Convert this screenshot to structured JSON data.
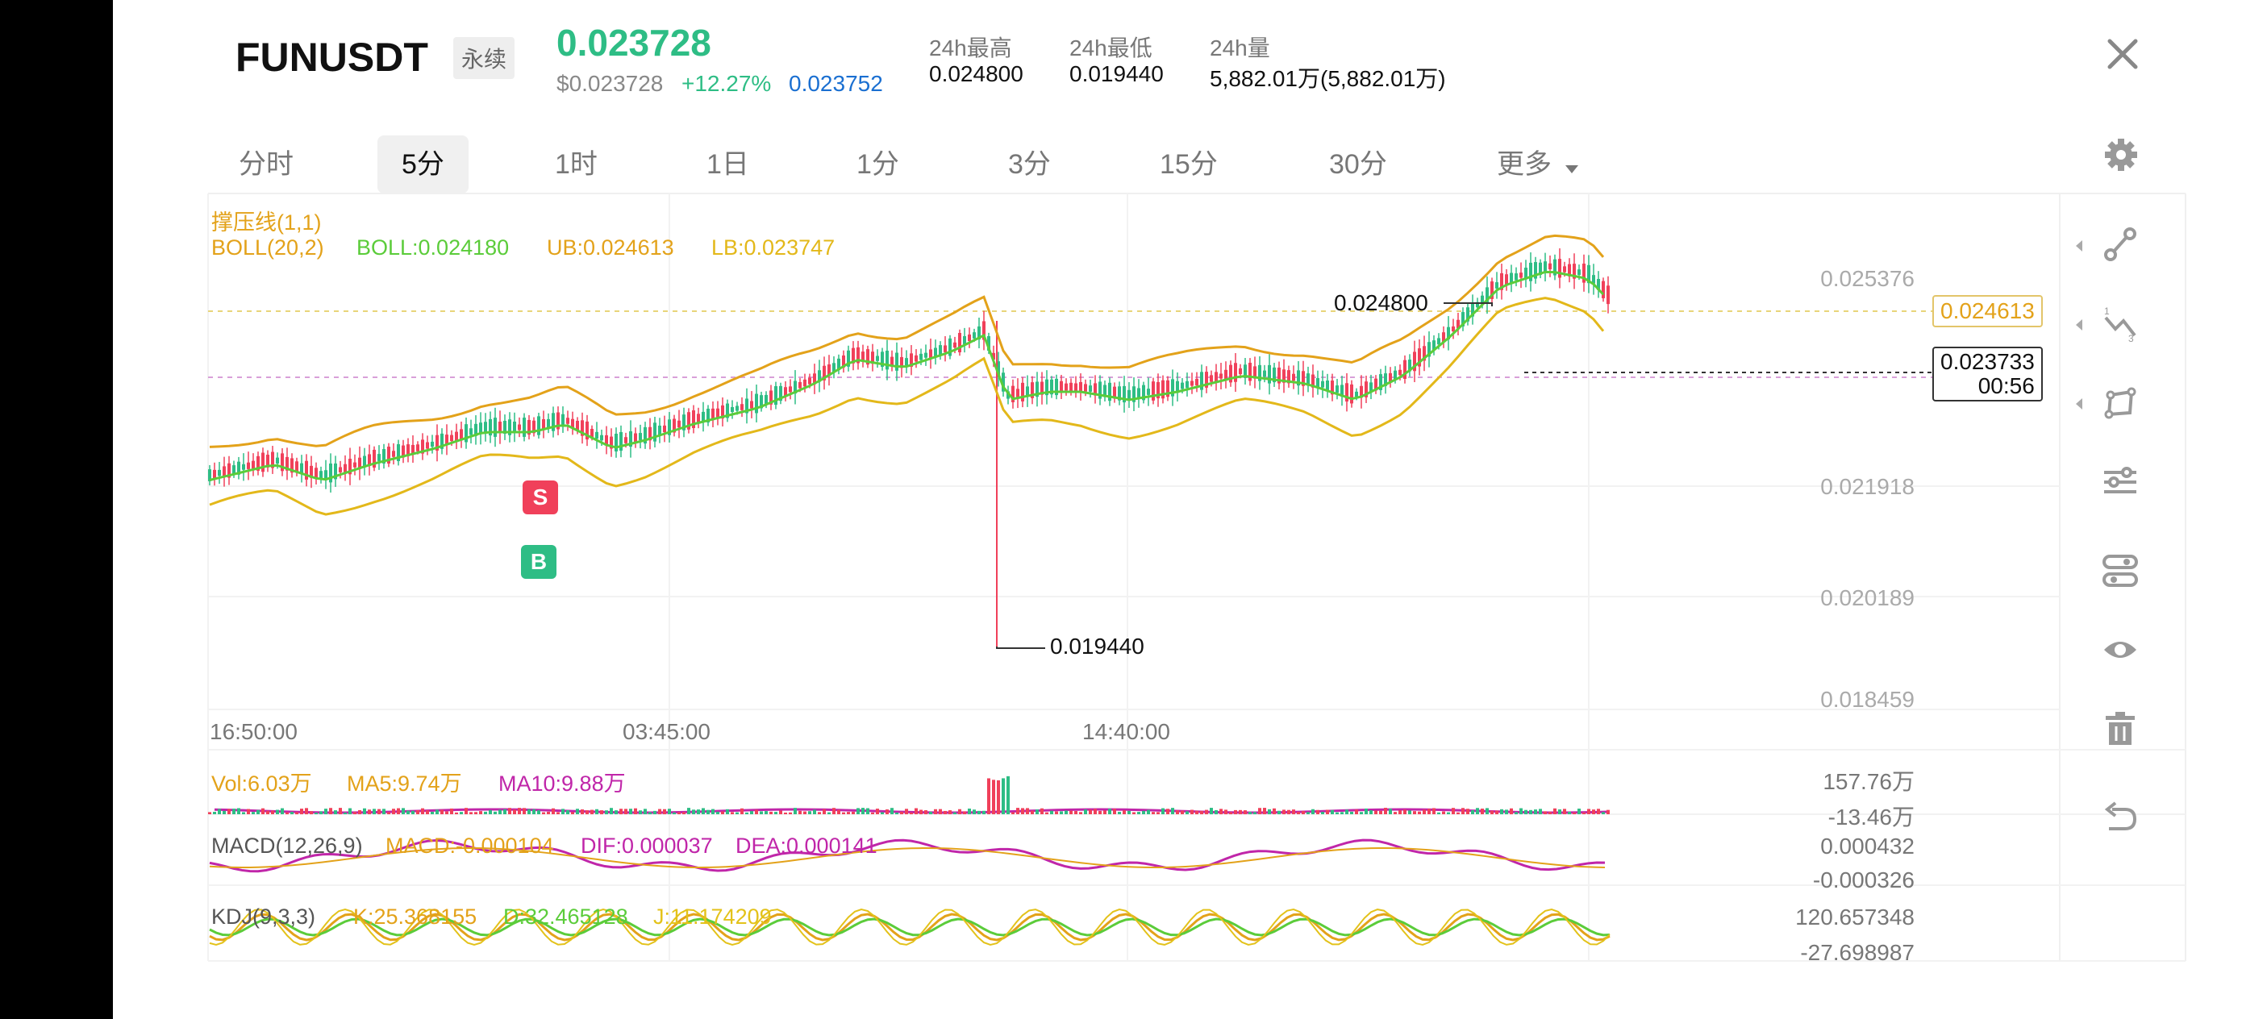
{
  "header": {
    "symbol": "FUNUSDT",
    "contract_type": "永续",
    "last_price": "0.023728",
    "usd_price": "$0.023728",
    "change_pct": "+12.27%",
    "mark_price": "0.023752",
    "stats": [
      {
        "label": "24h最高",
        "value": "0.024800"
      },
      {
        "label": "24h最低",
        "value": "0.019440"
      },
      {
        "label": "24h量",
        "value": "5,882.01万(5,882.01万)"
      }
    ],
    "close_icon": "close-icon"
  },
  "tabs": {
    "items": [
      "分时",
      "5分",
      "1时",
      "1日",
      "1分",
      "3分",
      "15分",
      "30分",
      "更多"
    ],
    "active": "5分",
    "settings_icon": "gear-icon"
  },
  "indicators": {
    "line1": "撑压线(1,1)",
    "boll_name": "BOLL(20,2)",
    "boll": "BOLL:0.024180",
    "ub": "UB:0.024613",
    "lb": "LB:0.023747",
    "vol": "Vol:6.03万",
    "ma5": "MA5:9.74万",
    "ma10": "MA10:9.88万",
    "macd_name": "MACD(12,26,9)",
    "macd": "MACD:-0.000104",
    "dif": "DIF:0.000037",
    "dea": "DEA:0.000141",
    "kdj_name": "KDJ(9,3,3)",
    "k": "K:25.368155",
    "d": "D:32.465128",
    "j": "J:11.174209"
  },
  "price_axis": [
    "0.025376",
    "0.021918",
    "0.020189",
    "0.018459"
  ],
  "price_tags": {
    "ub_tag": "0.024613",
    "current": "0.023733",
    "countdown": "00:56",
    "high_label": "0.024800",
    "low_label": "0.019440"
  },
  "time_axis": [
    "16:50:00",
    "03:45:00",
    "14:40:00"
  ],
  "vol_axis": [
    "157.76万",
    "-13.46万"
  ],
  "macd_axis": [
    "0.000432",
    "-0.000326"
  ],
  "kdj_axis": [
    "120.657348",
    "-27.698987"
  ],
  "markers": {
    "sell": "S",
    "buy": "B"
  },
  "colors": {
    "up": "#2ebd85",
    "down": "#f0405a",
    "boll_mid": "#5bcc3a",
    "boll_band": "#e3a21a",
    "ma10": "#c026a9",
    "link": "#1a6fd1"
  },
  "toolbar_icons": [
    "trendline-icon",
    "fibonacci-icon",
    "shape-icon",
    "adjust-icon",
    "settings-slider-icon",
    "eye-icon",
    "trash-icon",
    "undo-icon"
  ]
}
